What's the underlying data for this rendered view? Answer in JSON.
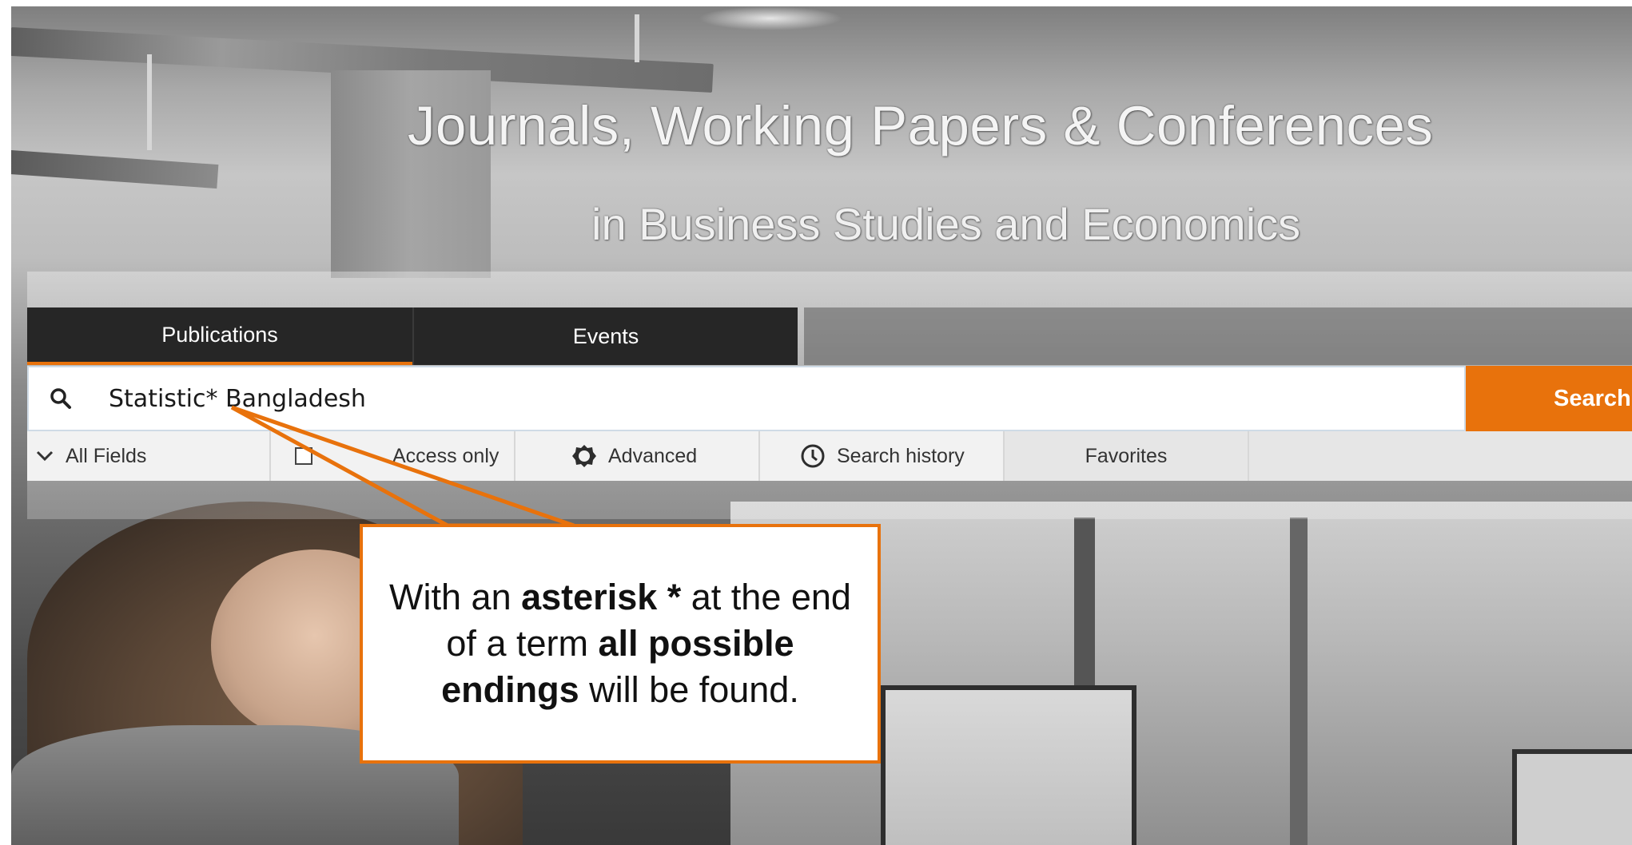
{
  "hero": {
    "title": "Journals, Working Papers & Conferences",
    "subtitle": "in Business Studies and Economics"
  },
  "tabs": [
    {
      "label": "Publications",
      "active": true
    },
    {
      "label": "Events",
      "active": false
    }
  ],
  "search": {
    "query": "Statistic* Bangladesh",
    "button_label": "Search",
    "icon": "search-icon"
  },
  "options": {
    "fields_label": "All Fields",
    "access_label": "Access only",
    "advanced_label": "Advanced",
    "history_label": "Search history",
    "favorites_label": "Favorites"
  },
  "callout": {
    "t1": "With an ",
    "b1": "asterisk *",
    "t2": " at the end of a term ",
    "b2": "all possible endings",
    "t3": " will be found."
  },
  "colors": {
    "accent": "#e8720c",
    "tab_background": "#262626",
    "option_background": "#f2f2f2"
  }
}
